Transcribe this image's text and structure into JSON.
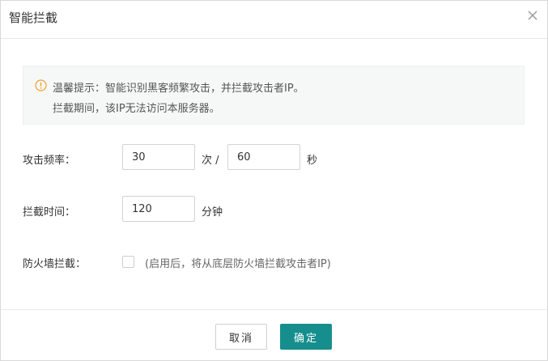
{
  "dialog": {
    "title": "智能拦截",
    "close_icon": "close-icon"
  },
  "notice": {
    "icon": "warning-circle-icon",
    "accent_color": "#f0a030",
    "line1": "温馨提示：智能识别黑客频繁攻击，并拦截攻击者IP。",
    "line2": "拦截期间，该IP无法访问本服务器。"
  },
  "form": {
    "frequency": {
      "label": "攻击频率：",
      "count_value": "30",
      "count_unit": "次 /",
      "seconds_value": "60",
      "seconds_unit": "秒"
    },
    "block_time": {
      "label": "拦截时间：",
      "value": "120",
      "unit": "分钟"
    },
    "firewall": {
      "label": "防火墙拦截：",
      "checked": false,
      "hint": "(启用后，将从底层防火墙拦截攻击者IP)"
    }
  },
  "footer": {
    "cancel_label": "取消",
    "ok_label": "确定",
    "ok_color": "#168e8e"
  }
}
